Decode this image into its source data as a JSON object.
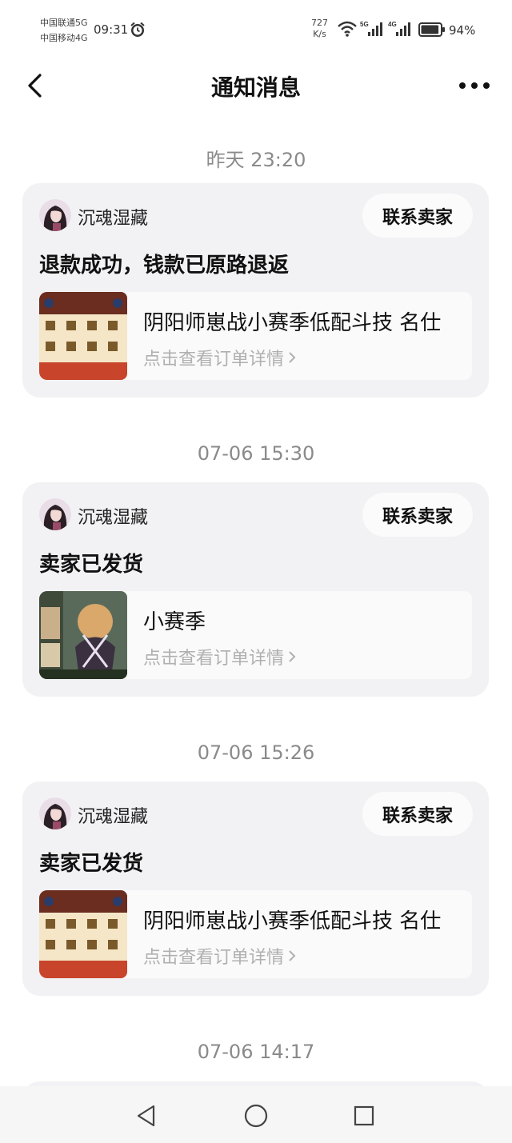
{
  "status_bar": {
    "carrier_1": "中国联通5G",
    "carrier_2": "中国移动4G",
    "time": "09:31",
    "net_speed_value": "727",
    "net_speed_unit": "K/s",
    "signal_1_label": "5G",
    "signal_2_label": "4G",
    "battery_percent": "94%",
    "battery_level": 0.94
  },
  "header": {
    "title": "通知消息"
  },
  "notifications": [
    {
      "time": "昨天 23:20",
      "seller": "沉魂湿藏",
      "contact_label": "联系卖家",
      "status": "退款成功，钱款已原路退返",
      "product_title": "阴阳师崽战小赛季低配斗技 名仕",
      "order_link": "点击查看订单详情"
    },
    {
      "time": "07-06 15:30",
      "seller": "沉魂湿藏",
      "contact_label": "联系卖家",
      "status": "卖家已发货",
      "product_title": "小赛季",
      "order_link": "点击查看订单详情"
    },
    {
      "time": "07-06 15:26",
      "seller": "沉魂湿藏",
      "contact_label": "联系卖家",
      "status": "卖家已发货",
      "product_title": "阴阳师崽战小赛季低配斗技 名仕",
      "order_link": "点击查看订单详情"
    },
    {
      "time": "07-06 14:17"
    }
  ],
  "icons": {
    "back": "chevron-left-icon",
    "more": "more-dots-icon",
    "alarm": "alarm-clock-icon",
    "wifi": "wifi-icon",
    "battery": "battery-icon",
    "nav_back": "triangle-back-icon",
    "nav_home": "circle-home-icon",
    "nav_recent": "square-recent-icon"
  },
  "colors": {
    "card_bg": "#f2f2f4",
    "time_label": "#8a8a8a",
    "link_gray": "#b0b0b0"
  }
}
